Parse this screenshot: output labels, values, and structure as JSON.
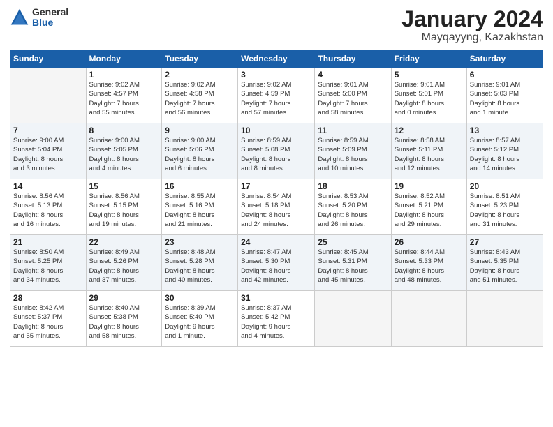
{
  "header": {
    "logo_general": "General",
    "logo_blue": "Blue",
    "month": "January 2024",
    "location": "Mayqayyng, Kazakhstan"
  },
  "weekdays": [
    "Sunday",
    "Monday",
    "Tuesday",
    "Wednesday",
    "Thursday",
    "Friday",
    "Saturday"
  ],
  "weeks": [
    [
      {
        "day": "",
        "info": ""
      },
      {
        "day": "1",
        "info": "Sunrise: 9:02 AM\nSunset: 4:57 PM\nDaylight: 7 hours\nand 55 minutes."
      },
      {
        "day": "2",
        "info": "Sunrise: 9:02 AM\nSunset: 4:58 PM\nDaylight: 7 hours\nand 56 minutes."
      },
      {
        "day": "3",
        "info": "Sunrise: 9:02 AM\nSunset: 4:59 PM\nDaylight: 7 hours\nand 57 minutes."
      },
      {
        "day": "4",
        "info": "Sunrise: 9:01 AM\nSunset: 5:00 PM\nDaylight: 7 hours\nand 58 minutes."
      },
      {
        "day": "5",
        "info": "Sunrise: 9:01 AM\nSunset: 5:01 PM\nDaylight: 8 hours\nand 0 minutes."
      },
      {
        "day": "6",
        "info": "Sunrise: 9:01 AM\nSunset: 5:03 PM\nDaylight: 8 hours\nand 1 minute."
      }
    ],
    [
      {
        "day": "7",
        "info": "Sunrise: 9:00 AM\nSunset: 5:04 PM\nDaylight: 8 hours\nand 3 minutes."
      },
      {
        "day": "8",
        "info": "Sunrise: 9:00 AM\nSunset: 5:05 PM\nDaylight: 8 hours\nand 4 minutes."
      },
      {
        "day": "9",
        "info": "Sunrise: 9:00 AM\nSunset: 5:06 PM\nDaylight: 8 hours\nand 6 minutes."
      },
      {
        "day": "10",
        "info": "Sunrise: 8:59 AM\nSunset: 5:08 PM\nDaylight: 8 hours\nand 8 minutes."
      },
      {
        "day": "11",
        "info": "Sunrise: 8:59 AM\nSunset: 5:09 PM\nDaylight: 8 hours\nand 10 minutes."
      },
      {
        "day": "12",
        "info": "Sunrise: 8:58 AM\nSunset: 5:11 PM\nDaylight: 8 hours\nand 12 minutes."
      },
      {
        "day": "13",
        "info": "Sunrise: 8:57 AM\nSunset: 5:12 PM\nDaylight: 8 hours\nand 14 minutes."
      }
    ],
    [
      {
        "day": "14",
        "info": "Sunrise: 8:56 AM\nSunset: 5:13 PM\nDaylight: 8 hours\nand 16 minutes."
      },
      {
        "day": "15",
        "info": "Sunrise: 8:56 AM\nSunset: 5:15 PM\nDaylight: 8 hours\nand 19 minutes."
      },
      {
        "day": "16",
        "info": "Sunrise: 8:55 AM\nSunset: 5:16 PM\nDaylight: 8 hours\nand 21 minutes."
      },
      {
        "day": "17",
        "info": "Sunrise: 8:54 AM\nSunset: 5:18 PM\nDaylight: 8 hours\nand 24 minutes."
      },
      {
        "day": "18",
        "info": "Sunrise: 8:53 AM\nSunset: 5:20 PM\nDaylight: 8 hours\nand 26 minutes."
      },
      {
        "day": "19",
        "info": "Sunrise: 8:52 AM\nSunset: 5:21 PM\nDaylight: 8 hours\nand 29 minutes."
      },
      {
        "day": "20",
        "info": "Sunrise: 8:51 AM\nSunset: 5:23 PM\nDaylight: 8 hours\nand 31 minutes."
      }
    ],
    [
      {
        "day": "21",
        "info": "Sunrise: 8:50 AM\nSunset: 5:25 PM\nDaylight: 8 hours\nand 34 minutes."
      },
      {
        "day": "22",
        "info": "Sunrise: 8:49 AM\nSunset: 5:26 PM\nDaylight: 8 hours\nand 37 minutes."
      },
      {
        "day": "23",
        "info": "Sunrise: 8:48 AM\nSunset: 5:28 PM\nDaylight: 8 hours\nand 40 minutes."
      },
      {
        "day": "24",
        "info": "Sunrise: 8:47 AM\nSunset: 5:30 PM\nDaylight: 8 hours\nand 42 minutes."
      },
      {
        "day": "25",
        "info": "Sunrise: 8:45 AM\nSunset: 5:31 PM\nDaylight: 8 hours\nand 45 minutes."
      },
      {
        "day": "26",
        "info": "Sunrise: 8:44 AM\nSunset: 5:33 PM\nDaylight: 8 hours\nand 48 minutes."
      },
      {
        "day": "27",
        "info": "Sunrise: 8:43 AM\nSunset: 5:35 PM\nDaylight: 8 hours\nand 51 minutes."
      }
    ],
    [
      {
        "day": "28",
        "info": "Sunrise: 8:42 AM\nSunset: 5:37 PM\nDaylight: 8 hours\nand 55 minutes."
      },
      {
        "day": "29",
        "info": "Sunrise: 8:40 AM\nSunset: 5:38 PM\nDaylight: 8 hours\nand 58 minutes."
      },
      {
        "day": "30",
        "info": "Sunrise: 8:39 AM\nSunset: 5:40 PM\nDaylight: 9 hours\nand 1 minute."
      },
      {
        "day": "31",
        "info": "Sunrise: 8:37 AM\nSunset: 5:42 PM\nDaylight: 9 hours\nand 4 minutes."
      },
      {
        "day": "",
        "info": ""
      },
      {
        "day": "",
        "info": ""
      },
      {
        "day": "",
        "info": ""
      }
    ]
  ]
}
